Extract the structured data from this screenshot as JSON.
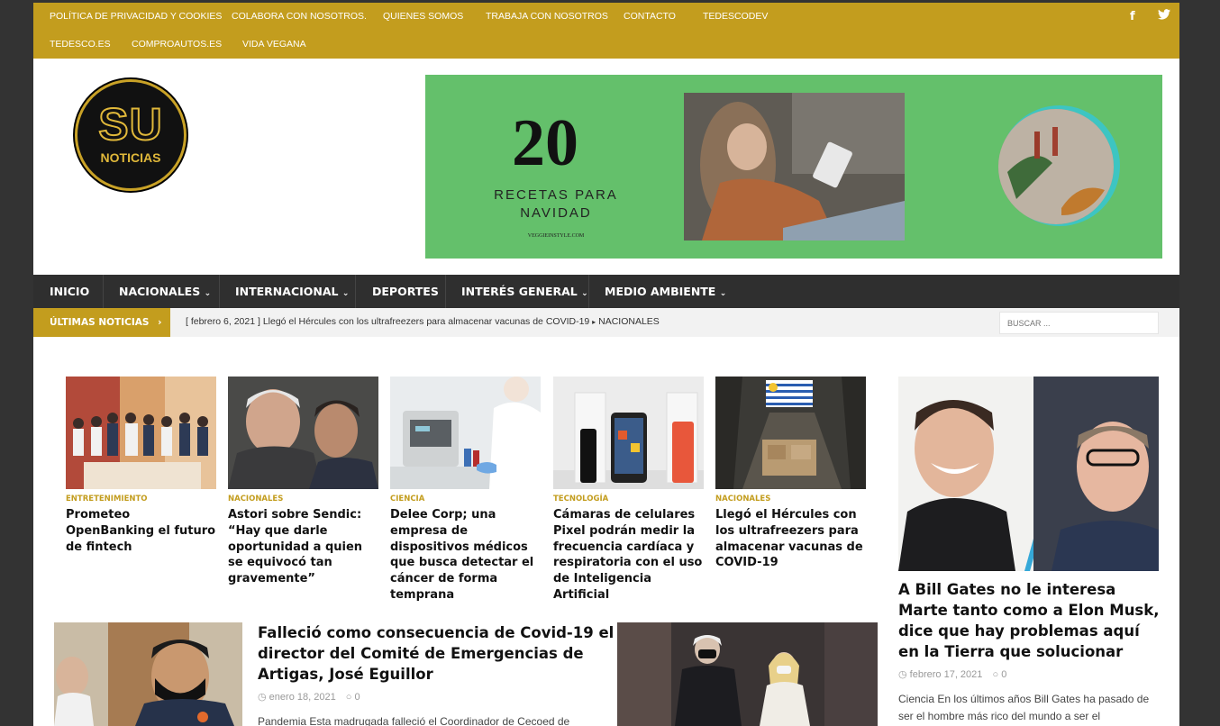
{
  "topbar": {
    "links_row1": [
      "POLÍTICA DE PRIVACIDAD Y COOKIES",
      "COLABORA CON NOSOTROS.",
      "QUIENES SOMOS",
      "TRABAJA CON NOSOTROS",
      "CONTACTO",
      "TEDESCODEV"
    ],
    "links_row2": [
      "TEDESCO.ES",
      "COMPROAUTOS.ES",
      "VIDA VEGANA"
    ],
    "social": [
      "facebook-icon",
      "twitter-icon"
    ]
  },
  "logo": {
    "line1": "SU",
    "line2": "NOTICIAS"
  },
  "banner": {
    "number": "20",
    "text": "RECETAS PARA NAVIDAD",
    "url": "VEGGIEINSTYLE.COM"
  },
  "nav": {
    "items": [
      "INICIO",
      "NACIONALES",
      "INTERNACIONAL",
      "DEPORTES",
      "INTERÉS GENERAL",
      "MEDIO AMBIENTE"
    ],
    "dropdown_indicator": "⌄"
  },
  "ticker": {
    "label": "ÚLTIMAS NOTICIAS",
    "date": "[ febrero 6, 2021 ]",
    "headline": "Llegó el Hércules con los ultrafreezers para almacenar vacunas de COVID-19",
    "category": "NACIONALES",
    "search_placeholder": "BUSCAR ..."
  },
  "cards": [
    {
      "category": "ENTRETENIMIENTO",
      "title": "Prometeo OpenBanking el futuro de fintech"
    },
    {
      "category": "NACIONALES",
      "title": "Astori sobre Sendic: “Hay que darle oportunidad a quien se equivocó tan gravemente”"
    },
    {
      "category": "CIENCIA",
      "title": "Delee Corp; una empresa de dispositivos médicos que busca detectar el cáncer de forma temprana"
    },
    {
      "category": "TECNOLOGÍA",
      "title": "Cámaras de celulares Pixel podrán medir la frecuencia cardíaca y respiratoria con el uso de Inteligencia Artificial"
    },
    {
      "category": "NACIONALES",
      "title": "Llegó el Hércules con los ultrafreezers para almacenar vacunas de COVID-19"
    }
  ],
  "featured": {
    "title": "A Bill Gates no le interesa Marte tanto como a Elon Musk, dice que hay problemas aquí en la Tierra que solucionar",
    "date": "febrero 17, 2021",
    "comments": "0",
    "excerpt": "Ciencia En los últimos años Bill Gates ha pasado de ser el hombre más rico del mundo a ser el"
  },
  "bottom_article": {
    "title": "Falleció como consecuencia de Covid-19 el director del Comité de Emergencias de Artigas, José Eguillor",
    "date": "enero 18, 2021",
    "comments": "0",
    "excerpt": "Pandemia Esta madrugada falleció el Coordinador de Cecoed de"
  },
  "colors": {
    "accent": "#c39d1e",
    "nav_bg": "#2f2f2f",
    "page_bg": "#333333"
  }
}
